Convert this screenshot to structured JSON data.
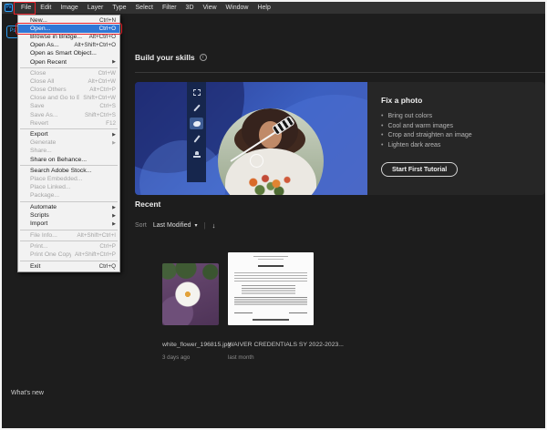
{
  "icons": {
    "submenu_arrow": "▶",
    "chevron_down": "▾",
    "sort_desc": "↓",
    "info": "i",
    "bullet": "•"
  },
  "menu_bar": {
    "app_icon_label": "Ps",
    "items": [
      "File",
      "Edit",
      "Image",
      "Layer",
      "Type",
      "Select",
      "Filter",
      "3D",
      "View",
      "Window",
      "Help"
    ]
  },
  "home_logo_label": "Ps",
  "file_menu": {
    "items": [
      {
        "label": "New...",
        "shortcut": "Ctrl+N"
      },
      {
        "label": "Open...",
        "shortcut": "Ctrl+O"
      },
      {
        "label": "Browse in Bridge...",
        "shortcut": "Alt+Ctrl+O"
      },
      {
        "label": "Open As...",
        "shortcut": "Alt+Shift+Ctrl+O"
      },
      {
        "label": "Open as Smart Object...",
        "shortcut": ""
      },
      {
        "label": "Open Recent",
        "shortcut": ""
      },
      {
        "label": "Close",
        "shortcut": "Ctrl+W"
      },
      {
        "label": "Close All",
        "shortcut": "Alt+Ctrl+W"
      },
      {
        "label": "Close Others",
        "shortcut": "Alt+Ctrl+P"
      },
      {
        "label": "Close and Go to Bridge...",
        "shortcut": "Shift+Ctrl+W"
      },
      {
        "label": "Save",
        "shortcut": "Ctrl+S"
      },
      {
        "label": "Save As...",
        "shortcut": "Shift+Ctrl+S"
      },
      {
        "label": "Revert",
        "shortcut": "F12"
      },
      {
        "label": "Export",
        "shortcut": ""
      },
      {
        "label": "Generate",
        "shortcut": ""
      },
      {
        "label": "Share...",
        "shortcut": ""
      },
      {
        "label": "Share on Behance...",
        "shortcut": ""
      },
      {
        "label": "Search Adobe Stock...",
        "shortcut": ""
      },
      {
        "label": "Place Embedded...",
        "shortcut": ""
      },
      {
        "label": "Place Linked...",
        "shortcut": ""
      },
      {
        "label": "Package...",
        "shortcut": ""
      },
      {
        "label": "Automate",
        "shortcut": ""
      },
      {
        "label": "Scripts",
        "shortcut": ""
      },
      {
        "label": "Import",
        "shortcut": ""
      },
      {
        "label": "File Info...",
        "shortcut": "Alt+Shift+Ctrl+I"
      },
      {
        "label": "Print...",
        "shortcut": "Ctrl+P"
      },
      {
        "label": "Print One Copy",
        "shortcut": "Alt+Shift+Ctrl+P"
      },
      {
        "label": "Exit",
        "shortcut": "Ctrl+Q"
      }
    ]
  },
  "home": {
    "skills_title": "Build your skills",
    "banner": {
      "title": "Fix a photo",
      "bullets": [
        "Bring out colors",
        "Cool and warm images",
        "Crop and straighten an image",
        "Lighten dark areas"
      ],
      "button": "Start First Tutorial"
    },
    "recent": {
      "title": "Recent",
      "sort_label": "Sort",
      "sort_value": "Last Modified",
      "files": [
        {
          "name": "white_flower_196815.jpg",
          "time": "3 days ago"
        },
        {
          "name": "WAIVER CREDENTIALS SY 2022-2023...",
          "time": "last month"
        }
      ]
    },
    "whats_new": "What's new"
  },
  "colors": {
    "annotation_red": "#e8202a",
    "selection_blue": "#2f77d6",
    "banner_blue": "#3b5fc0",
    "ps_blue": "#31a8ff",
    "background": "#1d1d1d"
  }
}
